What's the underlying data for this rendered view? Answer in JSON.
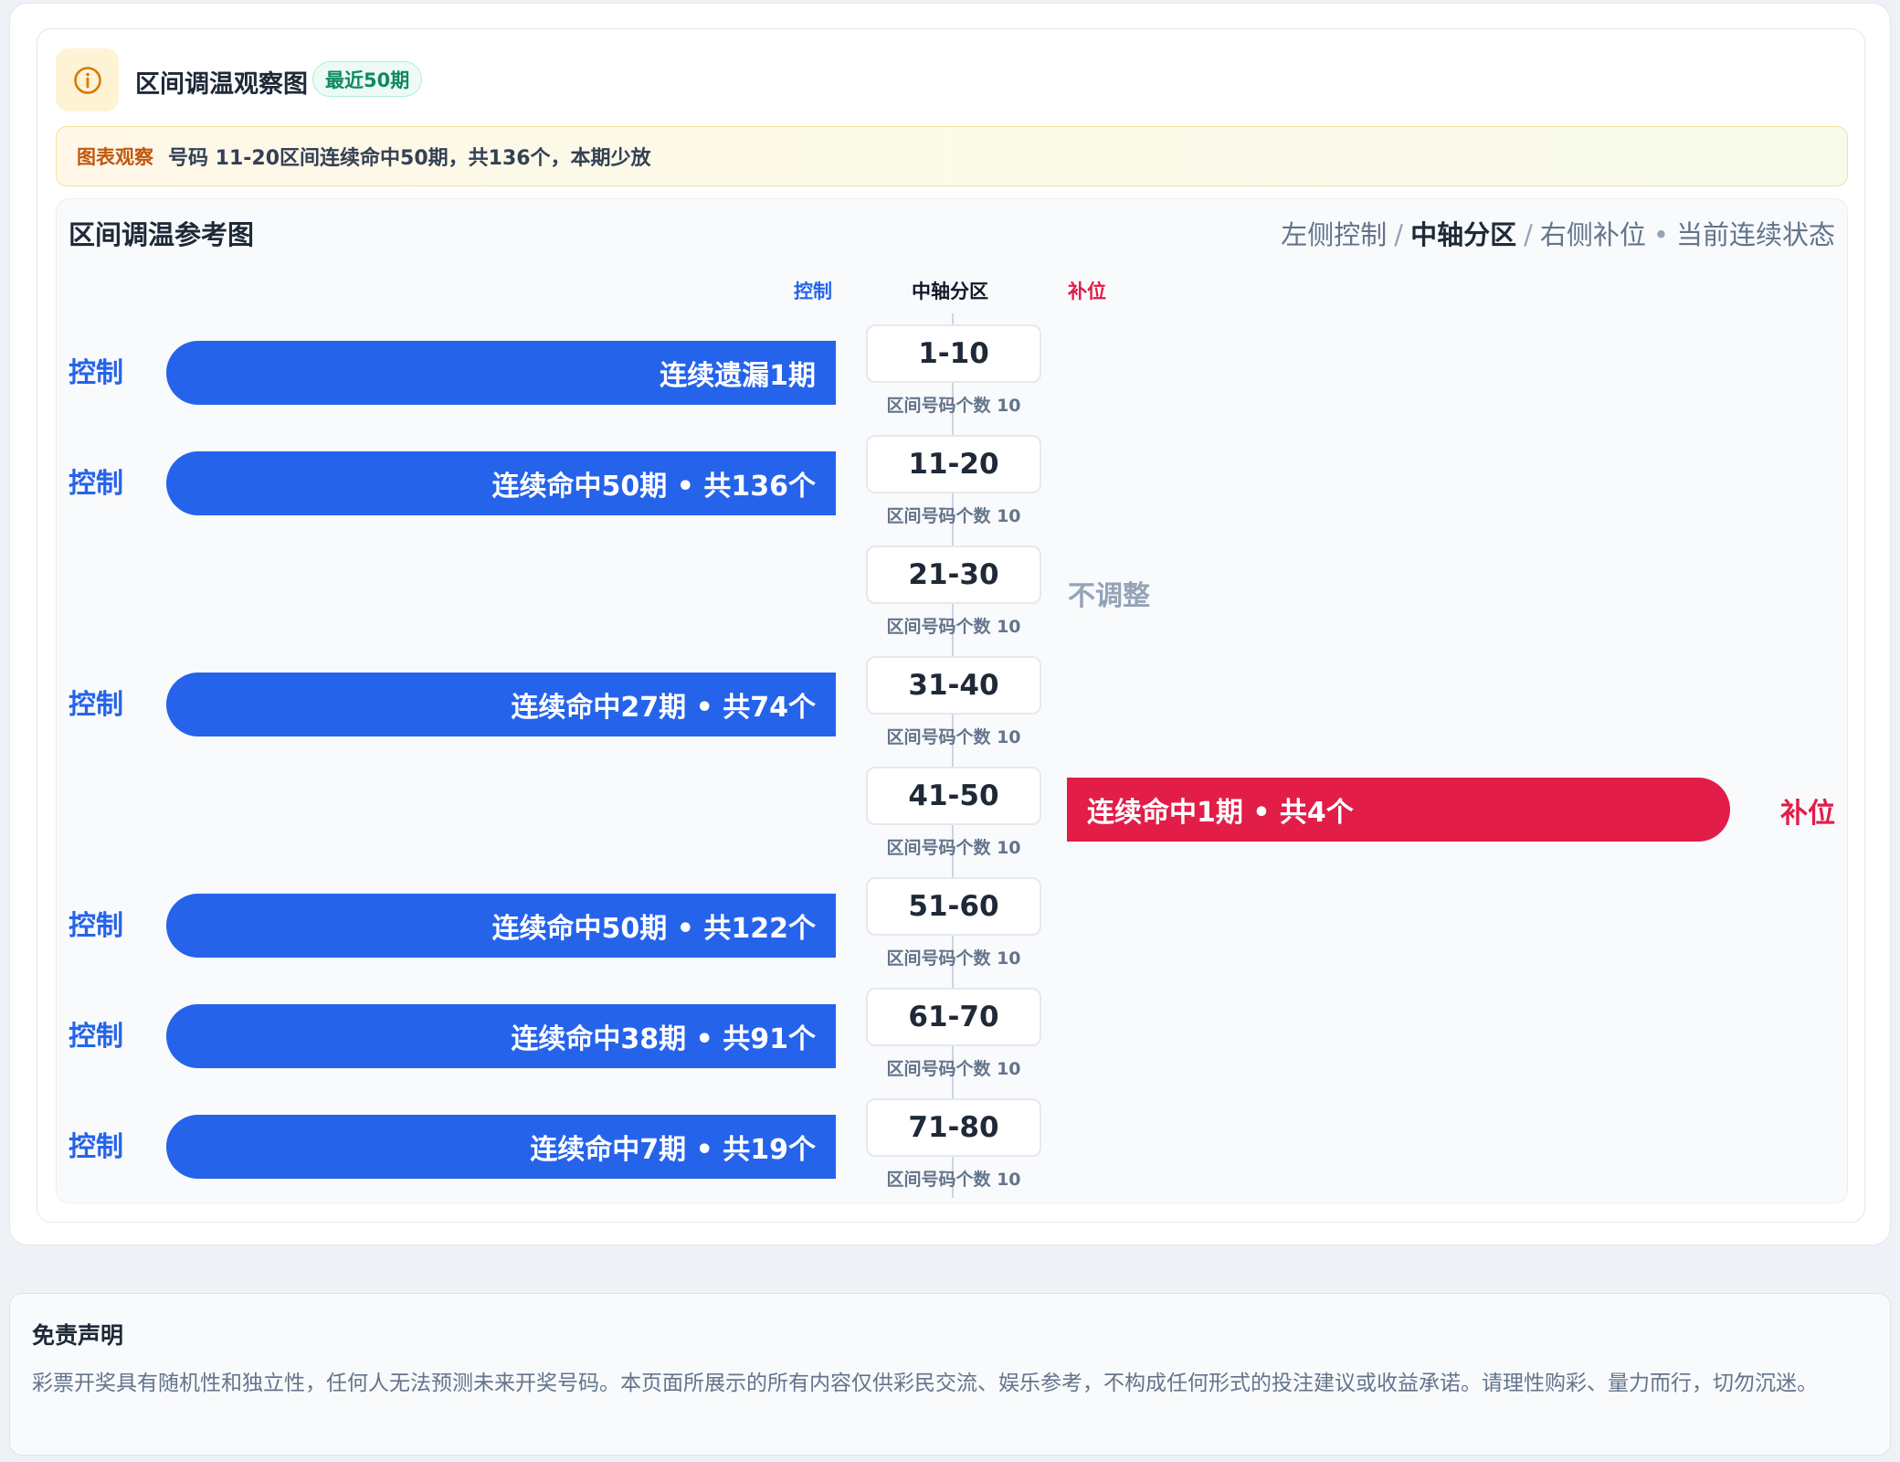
{
  "header": {
    "title": "区间调温观察图",
    "badge": "最近50期"
  },
  "notice": {
    "label": "图表观察",
    "text": "号码 11-20区间连续命中50期，共136个，本期少放"
  },
  "chart": {
    "title": "区间调温参考图",
    "legend": {
      "left": "左侧控制",
      "middle": "中轴分区",
      "right": "右侧补位",
      "dot": "•",
      "state": "当前连续状态",
      "slash": "/"
    },
    "col_heads": {
      "control": "控制",
      "axis": "中轴分区",
      "fill": "补位"
    },
    "no_adjust_label": "不调整"
  },
  "chart_data": {
    "type": "table",
    "rows": [
      {
        "range": "1-10",
        "sub": "区间号码个数 10",
        "side": "控制",
        "status": "连续遗漏1期"
      },
      {
        "range": "11-20",
        "sub": "区间号码个数 10",
        "side": "控制",
        "status": "连续命中50期 • 共136个"
      },
      {
        "range": "21-30",
        "sub": "区间号码个数 10",
        "side": "不调整",
        "status": ""
      },
      {
        "range": "31-40",
        "sub": "区间号码个数 10",
        "side": "控制",
        "status": "连续命中27期 • 共74个"
      },
      {
        "range": "41-50",
        "sub": "区间号码个数 10",
        "side": "补位",
        "status": "连续命中1期 • 共4个"
      },
      {
        "range": "51-60",
        "sub": "区间号码个数 10",
        "side": "控制",
        "status": "连续命中50期 • 共122个"
      },
      {
        "range": "61-70",
        "sub": "区间号码个数 10",
        "side": "控制",
        "status": "连续命中38期 • 共91个"
      },
      {
        "range": "71-80",
        "sub": "区间号码个数 10",
        "side": "控制",
        "status": "连续命中7期 • 共19个"
      }
    ]
  },
  "colors": {
    "control": "#2563eb",
    "fill": "#e11d48",
    "neutral": "#94a3b8",
    "badge": "#0f8a5f"
  },
  "disclaimer": {
    "title": "免责声明",
    "text": "彩票开奖具有随机性和独立性，任何人无法预测未来开奖号码。本页面所展示的所有内容仅供彩民交流、娱乐参考，不构成任何形式的投注建议或收益承诺。请理性购彩、量力而行，切勿沉迷。"
  }
}
